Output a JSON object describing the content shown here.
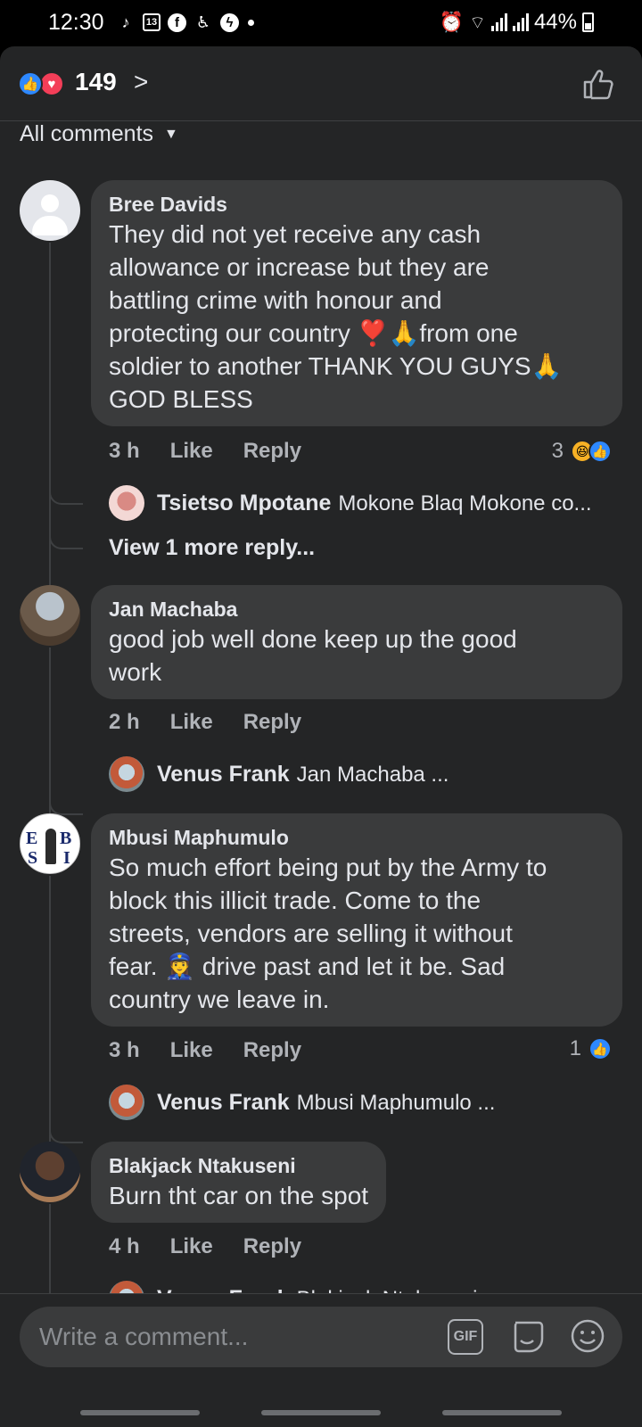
{
  "status_bar": {
    "time": "12:30",
    "calendar_day": "13",
    "battery": "44%"
  },
  "reactions": {
    "count": "149",
    "chevron": ">",
    "like_color": "#2d88ff",
    "love_color": "#f33e58"
  },
  "filter": {
    "label": "All comments",
    "caret": "⌄"
  },
  "comments": [
    {
      "name": "Bree Davids",
      "text": [
        "They did not yet receive any cash",
        "allowance or increase but they are",
        "battling crime with honour and",
        "protecting our country ❣️🙏from one",
        "soldier to another THANK YOU GUYS🙏",
        "GOD BLESS"
      ],
      "time": "3 h",
      "like": "Like",
      "reply": "Reply",
      "reaction_count": "3",
      "replies": [
        {
          "name": "Tsietso Mpotane",
          "text": "Mokone Blaq Mokone co..."
        }
      ],
      "more": "View 1 more reply..."
    },
    {
      "name": "Jan Machaba",
      "text": [
        "good job well done keep up the good",
        "work"
      ],
      "time": "2 h",
      "like": "Like",
      "reply": "Reply",
      "replies": [
        {
          "name": "Venus Frank",
          "text": "Jan Machaba ..."
        }
      ]
    },
    {
      "name": "Mbusi Maphumulo",
      "text": [
        "So much effort being put by the Army to",
        "block this illicit trade. Come to the",
        "streets, vendors are selling it without",
        "fear. 👮‍♀️ drive past and let it be. Sad",
        "country we leave in."
      ],
      "time": "3 h",
      "like": "Like",
      "reply": "Reply",
      "reaction_count": "1",
      "avatar_letters": [
        "E",
        "B",
        "S",
        "I"
      ],
      "replies": [
        {
          "name": "Venus Frank",
          "text": "Mbusi Maphumulo ..."
        }
      ]
    },
    {
      "name": "Blakjack Ntakuseni",
      "text": [
        "Burn tht car on the spot"
      ],
      "time": "4 h",
      "like": "Like",
      "reply": "Reply",
      "replies": [
        {
          "name": "Venus Frank",
          "text": "Blakjack Ntakuseni"
        }
      ]
    }
  ],
  "composer": {
    "placeholder": "Write a comment...",
    "gif_label": "GIF"
  }
}
